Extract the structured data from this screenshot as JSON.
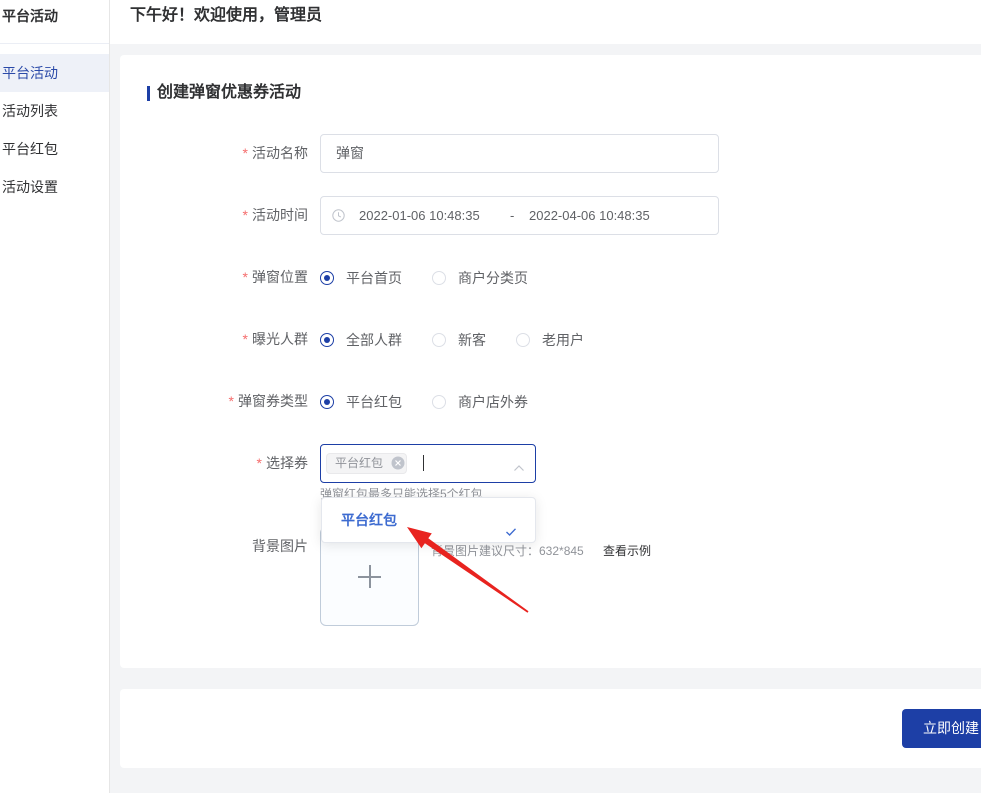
{
  "sidebar": {
    "title": "平台活动",
    "items": [
      {
        "label": "平台活动",
        "active": true
      },
      {
        "label": "活动列表",
        "active": false
      },
      {
        "label": "平台红包",
        "active": false
      },
      {
        "label": "活动设置",
        "active": false
      }
    ]
  },
  "header": {
    "greeting": "下午好！欢迎使用，管理员"
  },
  "form": {
    "title": "创建弹窗优惠券活动",
    "required_mark": "*",
    "name": {
      "label": "活动名称",
      "value": "弹窗"
    },
    "time": {
      "label": "活动时间",
      "icon": "clock-icon",
      "start": "2022-01-06 10:48:35",
      "separator": "-",
      "end": "2022-04-06 10:48:35"
    },
    "position": {
      "label": "弹窗位置",
      "options": [
        {
          "label": "平台首页",
          "checked": true
        },
        {
          "label": "商户分类页",
          "checked": false
        }
      ]
    },
    "audience": {
      "label": "曝光人群",
      "options": [
        {
          "label": "全部人群",
          "checked": true
        },
        {
          "label": "新客",
          "checked": false
        },
        {
          "label": "老用户",
          "checked": false
        }
      ]
    },
    "coupon_type": {
      "label": "弹窗券类型",
      "options": [
        {
          "label": "平台红包",
          "checked": true
        },
        {
          "label": "商户店外券",
          "checked": false
        }
      ]
    },
    "coupon": {
      "label": "选择券",
      "tags": [
        {
          "label": "平台红包",
          "icon": "close-circle-icon"
        }
      ],
      "toggle_icon": "chevron-up-icon",
      "hint": "弹窗红包最多只能选择5个红包",
      "dropdown": [
        {
          "label": "平台红包",
          "selected": true,
          "icon": "check-icon"
        }
      ]
    },
    "background": {
      "label": "背景图片",
      "upload_icon": "plus-icon",
      "tip": "背景图片建议尺寸：632*845",
      "example_link": "查看示例"
    }
  },
  "footer": {
    "submit_label": "立即创建"
  },
  "colors": {
    "primary": "#1d3fa6",
    "required": "#f56c6c",
    "annotation": "#e8231f",
    "option_active": "#3d6bd0"
  }
}
